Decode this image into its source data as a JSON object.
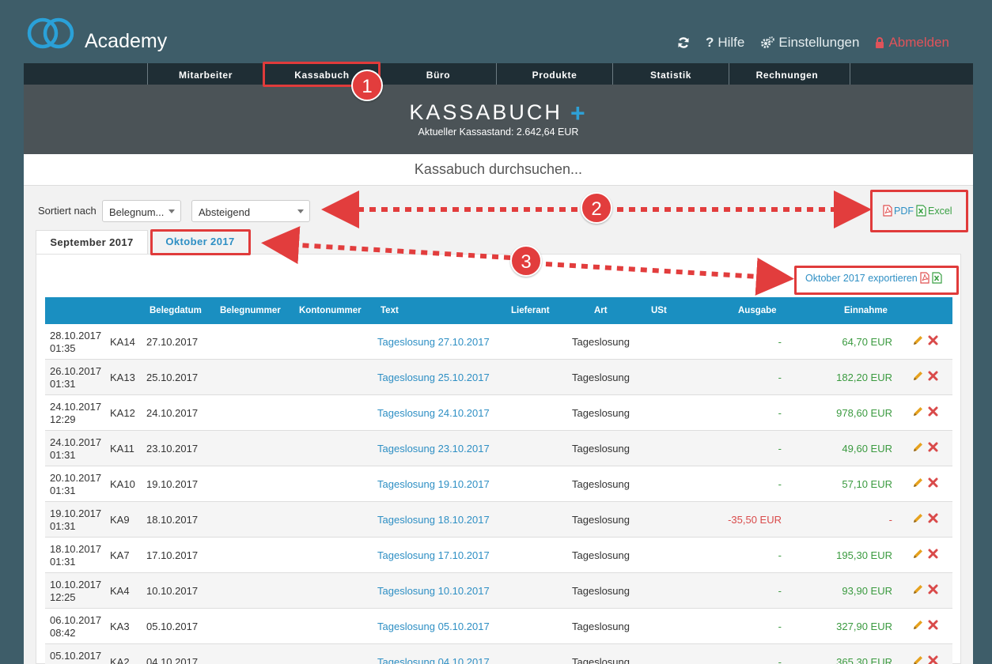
{
  "header": {
    "app_title": "Academy",
    "actions": {
      "refresh_icon": "refresh-icon",
      "help_label": "Hilfe",
      "settings_label": "Einstellungen",
      "logout_label": "Abmelden"
    }
  },
  "nav": {
    "items": [
      {
        "label": "Mitarbeiter"
      },
      {
        "label": "Kassabuch"
      },
      {
        "label": "Büro"
      },
      {
        "label": "Produkte"
      },
      {
        "label": "Statistik"
      },
      {
        "label": "Rechnungen"
      }
    ]
  },
  "hero": {
    "title": "KASSABUCH",
    "balance": "Aktueller Kassastand: 2.642,64 EUR"
  },
  "search": {
    "placeholder": "Kassabuch durchsuchen..."
  },
  "toolbar": {
    "sort_label": "Sortiert nach",
    "sort_field": "Belegnum...",
    "sort_order": "Absteigend",
    "pdf_label": "PDF",
    "excel_label": "Excel"
  },
  "tabs": [
    {
      "label": "September 2017"
    },
    {
      "label": "Oktober 2017"
    }
  ],
  "month_export": {
    "label": "Oktober 2017 exportieren"
  },
  "table": {
    "headers": {
      "belegdatum": "Belegdatum",
      "belegnummer": "Belegnummer",
      "kontonummer": "Kontonummer",
      "text": "Text",
      "lieferant": "Lieferant",
      "art": "Art",
      "ust": "USt",
      "ausgabe": "Ausgabe",
      "einnahme": "Einnahme"
    },
    "rows": [
      {
        "created_date": "28.10.2017",
        "created_time": "01:35",
        "nr": "KA14",
        "date": "27.10.2017",
        "text": "Tageslosung 27.10.2017",
        "art": "Tageslosung",
        "ausgabe": "-",
        "einnahme": "64,70 EUR"
      },
      {
        "created_date": "26.10.2017",
        "created_time": "01:31",
        "nr": "KA13",
        "date": "25.10.2017",
        "text": "Tageslosung 25.10.2017",
        "art": "Tageslosung",
        "ausgabe": "-",
        "einnahme": "182,20 EUR"
      },
      {
        "created_date": "24.10.2017",
        "created_time": "12:29",
        "nr": "KA12",
        "date": "24.10.2017",
        "text": "Tageslosung 24.10.2017",
        "art": "Tageslosung",
        "ausgabe": "-",
        "einnahme": "978,60 EUR"
      },
      {
        "created_date": "24.10.2017",
        "created_time": "01:31",
        "nr": "KA11",
        "date": "23.10.2017",
        "text": "Tageslosung 23.10.2017",
        "art": "Tageslosung",
        "ausgabe": "-",
        "einnahme": "49,60 EUR"
      },
      {
        "created_date": "20.10.2017",
        "created_time": "01:31",
        "nr": "KA10",
        "date": "19.10.2017",
        "text": "Tageslosung 19.10.2017",
        "art": "Tageslosung",
        "ausgabe": "-",
        "einnahme": "57,10 EUR"
      },
      {
        "created_date": "19.10.2017",
        "created_time": "01:31",
        "nr": "KA9",
        "date": "18.10.2017",
        "text": "Tageslosung 18.10.2017",
        "art": "Tageslosung",
        "ausgabe": "-35,50 EUR",
        "einnahme": "-"
      },
      {
        "created_date": "18.10.2017",
        "created_time": "01:31",
        "nr": "KA7",
        "date": "17.10.2017",
        "text": "Tageslosung 17.10.2017",
        "art": "Tageslosung",
        "ausgabe": "-",
        "einnahme": "195,30 EUR"
      },
      {
        "created_date": "10.10.2017",
        "created_time": "12:25",
        "nr": "KA4",
        "date": "10.10.2017",
        "text": "Tageslosung 10.10.2017",
        "art": "Tageslosung",
        "ausgabe": "-",
        "einnahme": "93,90 EUR"
      },
      {
        "created_date": "06.10.2017",
        "created_time": "08:42",
        "nr": "KA3",
        "date": "05.10.2017",
        "text": "Tageslosung 05.10.2017",
        "art": "Tageslosung",
        "ausgabe": "-",
        "einnahme": "327,90 EUR"
      },
      {
        "created_date": "05.10.2017",
        "created_time": "",
        "nr": "KA2",
        "date": "04.10.2017",
        "text": "Tageslosung 04.10.2017",
        "art": "Tageslosung",
        "ausgabe": "-",
        "einnahme": "365,30 EUR"
      }
    ]
  },
  "annotations": {
    "badges": [
      "1",
      "2",
      "3"
    ],
    "color": "#e23d3d"
  },
  "colors": {
    "background": "#3e5d69",
    "nav": "#1f2e35",
    "hero": "#4b5357",
    "table_header": "#1a8fc1",
    "link": "#2e8fc4",
    "income": "#3a9a3f",
    "expense": "#d94a4a"
  }
}
